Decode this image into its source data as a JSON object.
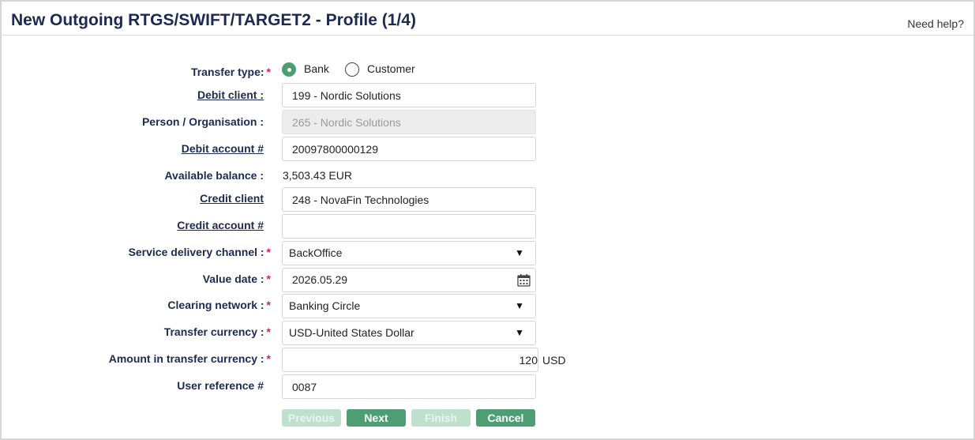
{
  "header": {
    "title": "New Outgoing RTGS/SWIFT/TARGET2 - Profile (1/4)",
    "help_link": "Need help?"
  },
  "form": {
    "required_mark": "*",
    "transfer_type": {
      "label": "Transfer type:",
      "options": [
        "Bank",
        "Customer"
      ],
      "selected": "Bank"
    },
    "debit_client": {
      "label": "Debit client :",
      "value": "199 - Nordic Solutions"
    },
    "person_org": {
      "label": "Person / Organisation :",
      "value": "265 - Nordic Solutions"
    },
    "debit_account": {
      "label": "Debit account #",
      "value": "20097800000129"
    },
    "available_balance": {
      "label": "Available balance :",
      "value": "3,503.43 EUR"
    },
    "credit_client": {
      "label": "Credit client",
      "value": "248 - NovaFin Technologies"
    },
    "credit_account": {
      "label": "Credit account #",
      "value": ""
    },
    "service_channel": {
      "label": "Service delivery channel :",
      "value": "BackOffice"
    },
    "value_date": {
      "label": "Value date :",
      "value": "2026.05.29"
    },
    "clearing_network": {
      "label": "Clearing network :",
      "value": "Banking Circle"
    },
    "transfer_currency": {
      "label": "Transfer currency :",
      "value": "USD-United States Dollar"
    },
    "amount": {
      "label": "Amount in transfer currency :",
      "value": "120",
      "unit": "USD"
    },
    "user_reference": {
      "label": "User reference #",
      "value": "0087"
    }
  },
  "buttons": {
    "previous": "Previous",
    "next": "Next",
    "finish": "Finish",
    "cancel": "Cancel"
  },
  "icons": {
    "dropdown": "caret-down-icon",
    "calendar": "calendar-icon"
  },
  "colors": {
    "accent": "#4e9e74",
    "accent_disabled": "#bfe0cd",
    "required": "#d0216c",
    "title": "#1c2a52"
  }
}
